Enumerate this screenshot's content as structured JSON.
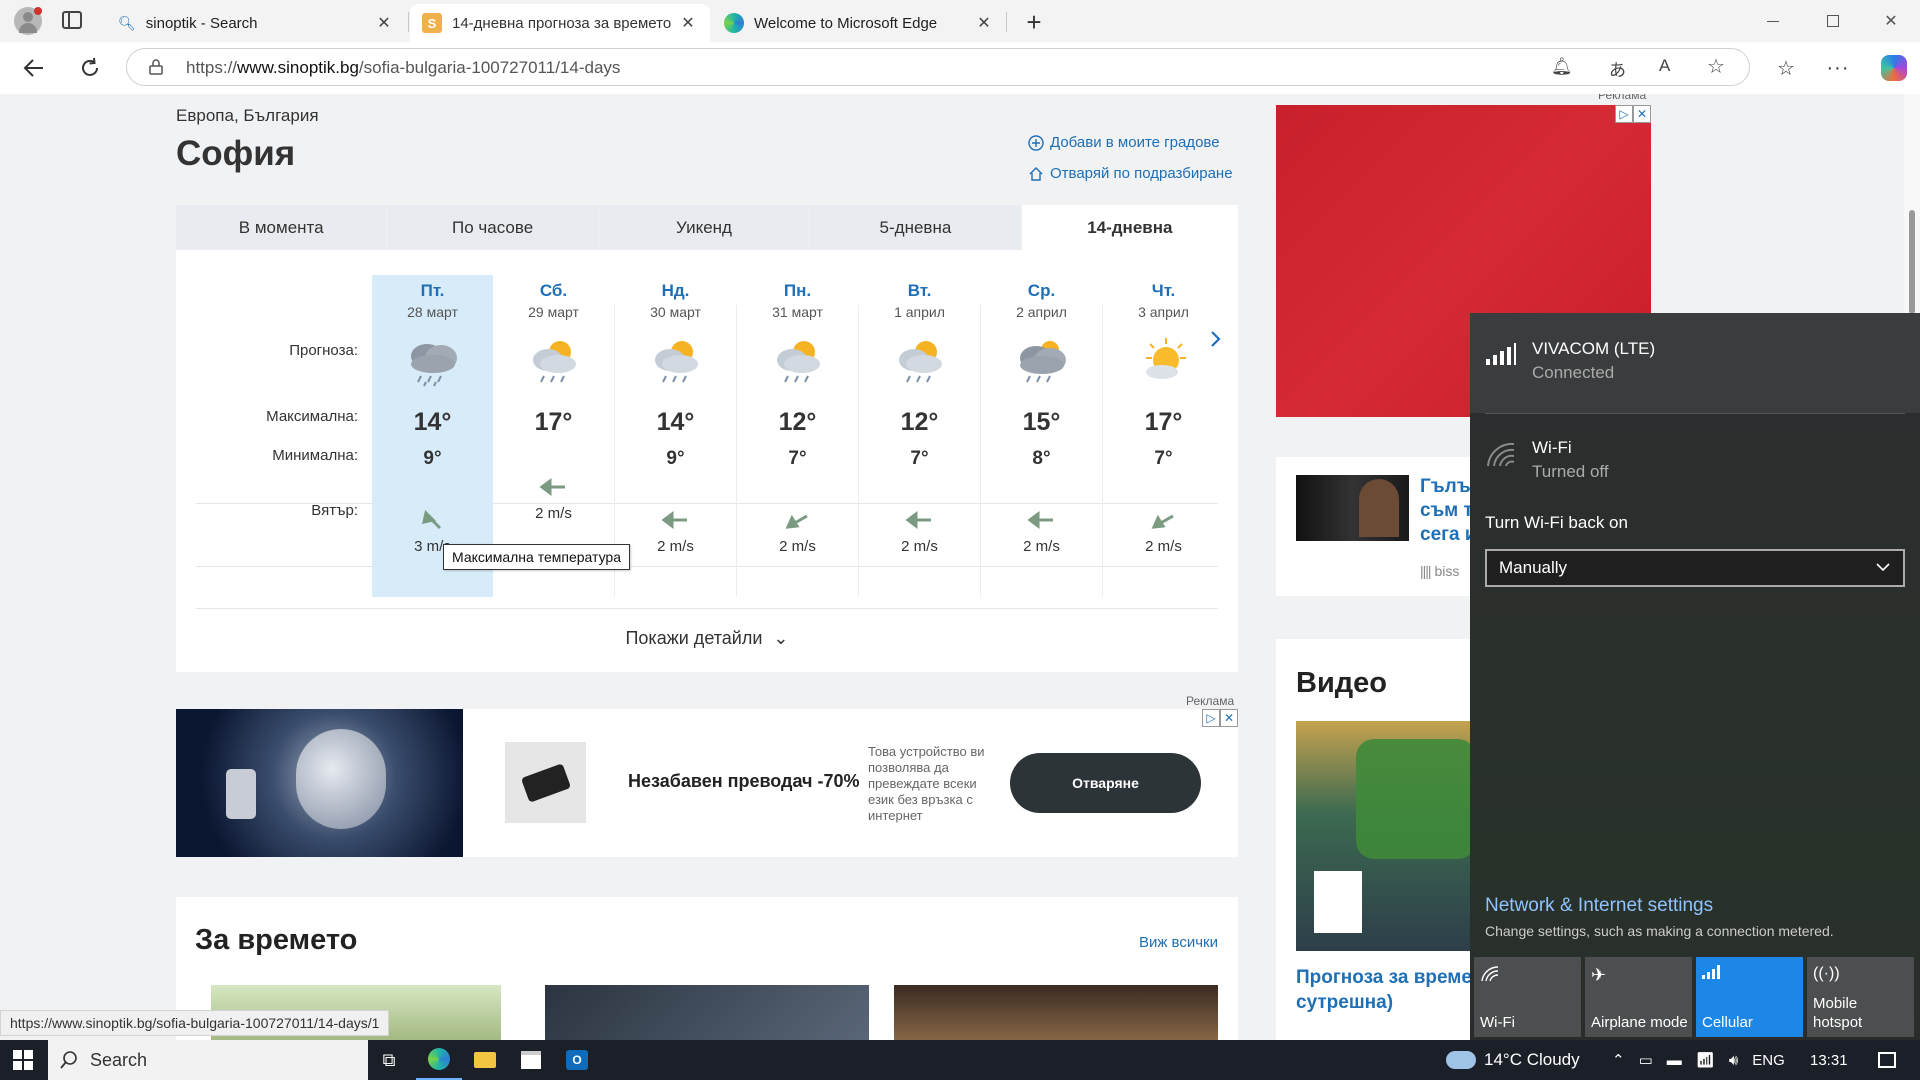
{
  "browser": {
    "tabs": [
      {
        "title": "sinoptik - Search",
        "close": "✕",
        "icon": "search-icon"
      },
      {
        "title": "14-дневна прогноза за времето",
        "close": "✕",
        "icon": "sinoptik-icon"
      },
      {
        "title": "Welcome to Microsoft Edge",
        "close": "✕",
        "icon": "edge-icon"
      }
    ],
    "new_tab": "+",
    "url_prefix": "https://",
    "url_host": "www.sinoptik.bg",
    "url_path": "/sofia-bulgaria-100727011/14-days"
  },
  "page": {
    "breadcrumb": "Европа, България",
    "city": "София",
    "add_city": "Добави в моите градове",
    "open_default": "Отваряй по подразбиране",
    "tabs": [
      "В момента",
      "По часове",
      "Уикенд",
      "5-дневна",
      "14-дневна"
    ],
    "active_tab": "14-дневна",
    "labels": {
      "forecast": "Прогноза:",
      "max": "Максимална:",
      "min": "Минимална:",
      "wind": "Вятър:"
    },
    "days": [
      {
        "name": "Пт.",
        "date": "28 март",
        "icon": "rain-cloud-icon",
        "max": "14°",
        "min": "9°",
        "wind": "3 m/s"
      },
      {
        "name": "Сб.",
        "date": "29 март",
        "icon": "sun-rain-icon",
        "max": "17°",
        "min": "",
        "wind": "2 m/s"
      },
      {
        "name": "Нд.",
        "date": "30 март",
        "icon": "sun-rain-icon",
        "max": "14°",
        "min": "9°",
        "wind": "2 m/s"
      },
      {
        "name": "Пн.",
        "date": "31 март",
        "icon": "sun-rain-icon",
        "max": "12°",
        "min": "7°",
        "wind": "2 m/s"
      },
      {
        "name": "Вт.",
        "date": "1 април",
        "icon": "sun-rain-icon",
        "max": "12°",
        "min": "7°",
        "wind": "2 m/s"
      },
      {
        "name": "Ср.",
        "date": "2 април",
        "icon": "rain-cloud-icon",
        "max": "15°",
        "min": "8°",
        "wind": "2 m/s"
      },
      {
        "name": "Чт.",
        "date": "3 април",
        "icon": "sun-cloud-icon",
        "max": "17°",
        "min": "7°",
        "wind": "2 m/s"
      }
    ],
    "tooltip": "Максимална температура",
    "details": "Покажи детайли",
    "ad_label": "Реклама",
    "ad": {
      "headline": "Незабавен преводач -70%",
      "description": "Това устройство ви позволява да превеждате всеки език без връзка с интернет",
      "cta": "Отваряне"
    },
    "about": {
      "title": "За времето",
      "see_all": "Виж всички"
    },
    "news": {
      "title": "Гълъ съм т сега и",
      "source": "biss"
    },
    "video": {
      "title": "Видео",
      "caption": "Прогноза за време сутрешна)"
    },
    "status_url": "https://www.sinoptik.bg/sofia-bulgaria-100727011/14-days/1"
  },
  "network": {
    "cellular": {
      "name": "VIVACOM (LTE)",
      "status": "Connected"
    },
    "wifi": {
      "name": "Wi-Fi",
      "status": "Turned off"
    },
    "wifi_back_label": "Turn Wi-Fi back on",
    "wifi_back_value": "Manually",
    "settings_link": "Network & Internet settings",
    "settings_sub": "Change settings, such as making a connection metered.",
    "quick_actions": [
      {
        "label": "Wi-Fi",
        "on": false
      },
      {
        "label": "Airplane mode",
        "on": false
      },
      {
        "label": "Cellular",
        "on": true
      },
      {
        "label": "Mobile hotspot",
        "on": false
      }
    ]
  },
  "taskbar": {
    "search": "Search",
    "weather": "14°C  Cloudy",
    "lang": "ENG",
    "time": "13:31"
  },
  "colors": {
    "accent": "#1e6fb5",
    "selected_day": "#d7ebf8",
    "ad_red": "#d52a35",
    "cellular_on": "#1c87e6"
  }
}
